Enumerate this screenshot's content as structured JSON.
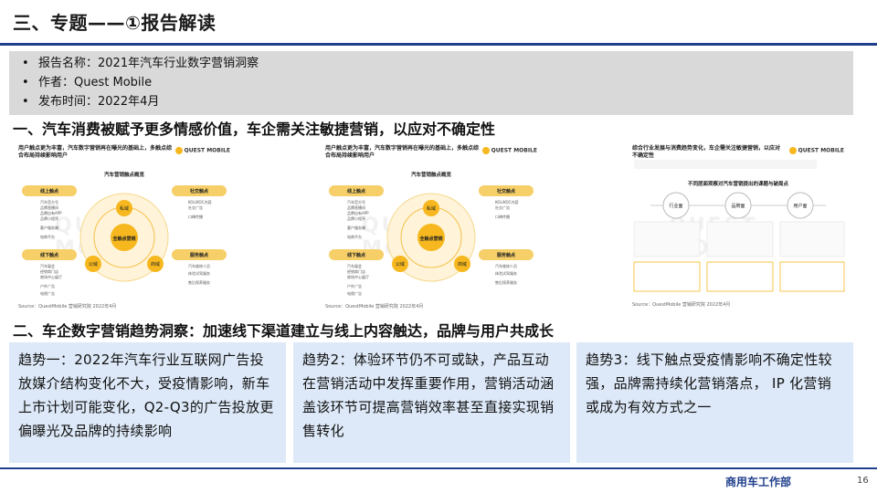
{
  "slide": {
    "title": "三、专题——①报告解读",
    "page_number": "16",
    "department": "商用车工作部"
  },
  "info": {
    "bullet": "•",
    "items": [
      "报告名称：2021年汽车行业数字营销洞察",
      "作者：Quest Mobile",
      "发布时间：2022年4月"
    ]
  },
  "section1": {
    "heading": "一、汽车消费被赋予更多情感价值，车企需关注敏捷营销，以应对不确定性"
  },
  "section2": {
    "heading": "二、车企数字营销趋势洞察：加速线下渠道建立与线上内容触达，品牌与用户共成长"
  },
  "thumbnails": [
    {
      "caption": "用户触点更为丰富，汽车数字营销再在曝光的基础上，多触点综合布局持续影响用户",
      "logo": "QUEST MOBILE",
      "chart_title": "汽车营销触点概览",
      "center": "全触点营销",
      "nodes": [
        "私域",
        "公域",
        "商域"
      ],
      "groups": [
        {
          "title": "线上触点",
          "items": [
            "汽车官方号",
            "品牌直播间",
            "品牌自有APP",
            "品牌小程序",
            "客户服务端",
            "电商平台"
          ]
        },
        {
          "title": "社交触点",
          "items": [
            "KOL/KOC内容",
            "社交广告",
            "口碑传播"
          ]
        },
        {
          "title": "线下触点",
          "items": [
            "汽车展会",
            "经销商门店",
            "商场中心展厅",
            "户外广告",
            "电视广告"
          ]
        },
        {
          "title": "服务触点",
          "items": [
            "汽车维修人员",
            "体验试驾服务",
            "售后保养服务"
          ]
        }
      ],
      "source": "Source：QuestMobile 营销研究院 2022年4月",
      "watermark": "QUEST MOBILE"
    },
    {
      "caption": "用户触点更为丰富，汽车数字营销再在曝光的基础上，多触点综合布局持续影响用户",
      "logo": "QUEST MOBILE",
      "chart_title": "汽车营销触点概览",
      "center": "全触点营销",
      "nodes": [
        "私域",
        "公域",
        "商域"
      ],
      "groups": [
        {
          "title": "线上触点",
          "items": [
            "汽车官方号",
            "品牌直播间",
            "品牌自有APP",
            "品牌小程序",
            "客户服务端",
            "电商平台"
          ]
        },
        {
          "title": "社交触点",
          "items": [
            "KOL/KOC内容",
            "社交广告",
            "口碑传播"
          ]
        },
        {
          "title": "线下触点",
          "items": [
            "汽车展会",
            "经销商门店",
            "商场中心展厅",
            "户外广告",
            "电视广告"
          ]
        },
        {
          "title": "服务触点",
          "items": [
            "汽车维修人员",
            "体验试驾服务",
            "售后保养服务"
          ]
        }
      ],
      "source": "Source：QuestMobile 营销研究院 2022年4月",
      "watermark": "QUEST MOBILE"
    },
    {
      "caption": "综合行业发展与消费趋势变化，车企需关注敏捷营销，以应对不确定性",
      "logo": "QUEST MOBILE",
      "chart_title": "不同层面观察对汽车营销提出的课题与破局点",
      "nodes": [
        "行业面",
        "品牌面",
        "用户面"
      ],
      "source": "Source：QuestMobile 营销研究院 2022年4月",
      "watermark": "QUEST MOBILE"
    }
  ],
  "trends": [
    {
      "text": "趋势一：2022年汽车行业互联网广告投放媒介结构变化不大，受疫情影响，新车上市计划可能变化，Q2-Q3的广告投放更偏曝光及品牌的持续影响"
    },
    {
      "text": "趋势2：体验环节仍不可或缺，产品互动在营销活动中发挥重要作用，营销活动涵盖该环节可提高营销效率甚至直接实现销售转化"
    },
    {
      "text": "趋势3：线下触点受疫情影响不确定性较强，品牌需持续化营销落点， IP 化营销或成为有效方式之一"
    }
  ],
  "colors": {
    "accent_blue": "#1f3f8c",
    "info_gray": "#d9d9d9",
    "panel_blue": "#dde9f8",
    "highlight_yellow": "#f6b81e"
  }
}
